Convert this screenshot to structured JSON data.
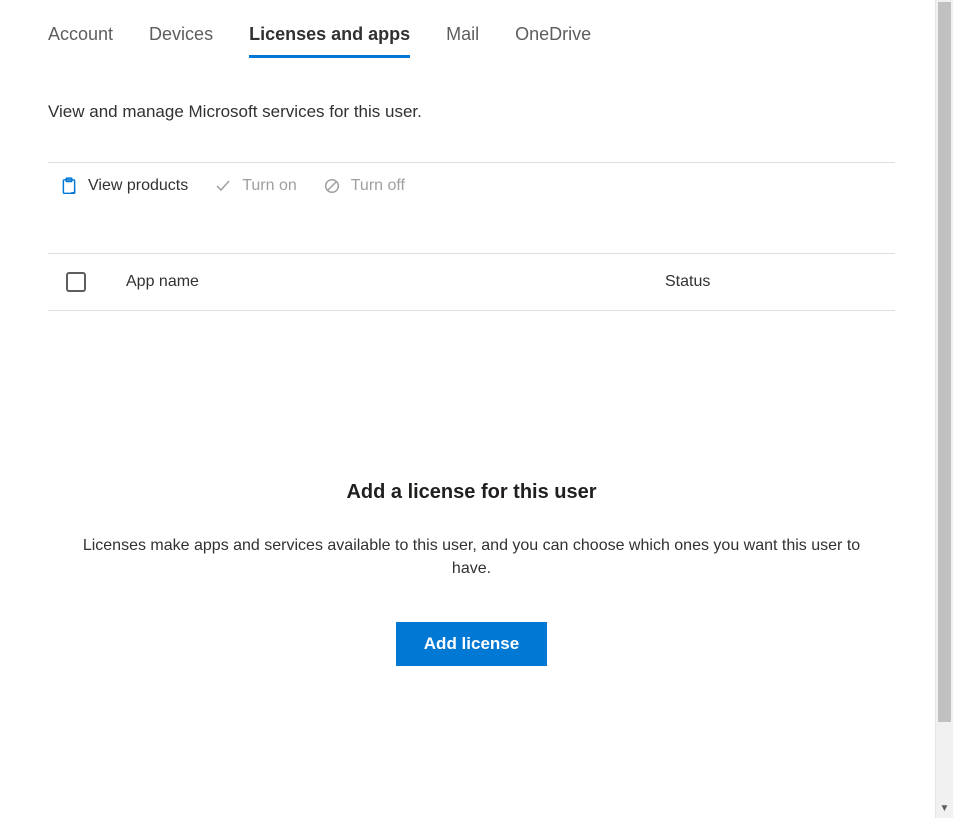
{
  "tabs": [
    {
      "label": "Account",
      "active": false
    },
    {
      "label": "Devices",
      "active": false
    },
    {
      "label": "Licenses and apps",
      "active": true
    },
    {
      "label": "Mail",
      "active": false
    },
    {
      "label": "OneDrive",
      "active": false
    }
  ],
  "subtitle": "View and manage Microsoft services for this user.",
  "commands": {
    "view_products": "View products",
    "turn_on": "Turn on",
    "turn_off": "Turn off"
  },
  "table": {
    "col_app_name": "App name",
    "col_status": "Status"
  },
  "empty_state": {
    "title": "Add a license for this user",
    "description": "Licenses make apps and services available to this user, and you can choose which ones you want this user to have.",
    "button": "Add license"
  }
}
